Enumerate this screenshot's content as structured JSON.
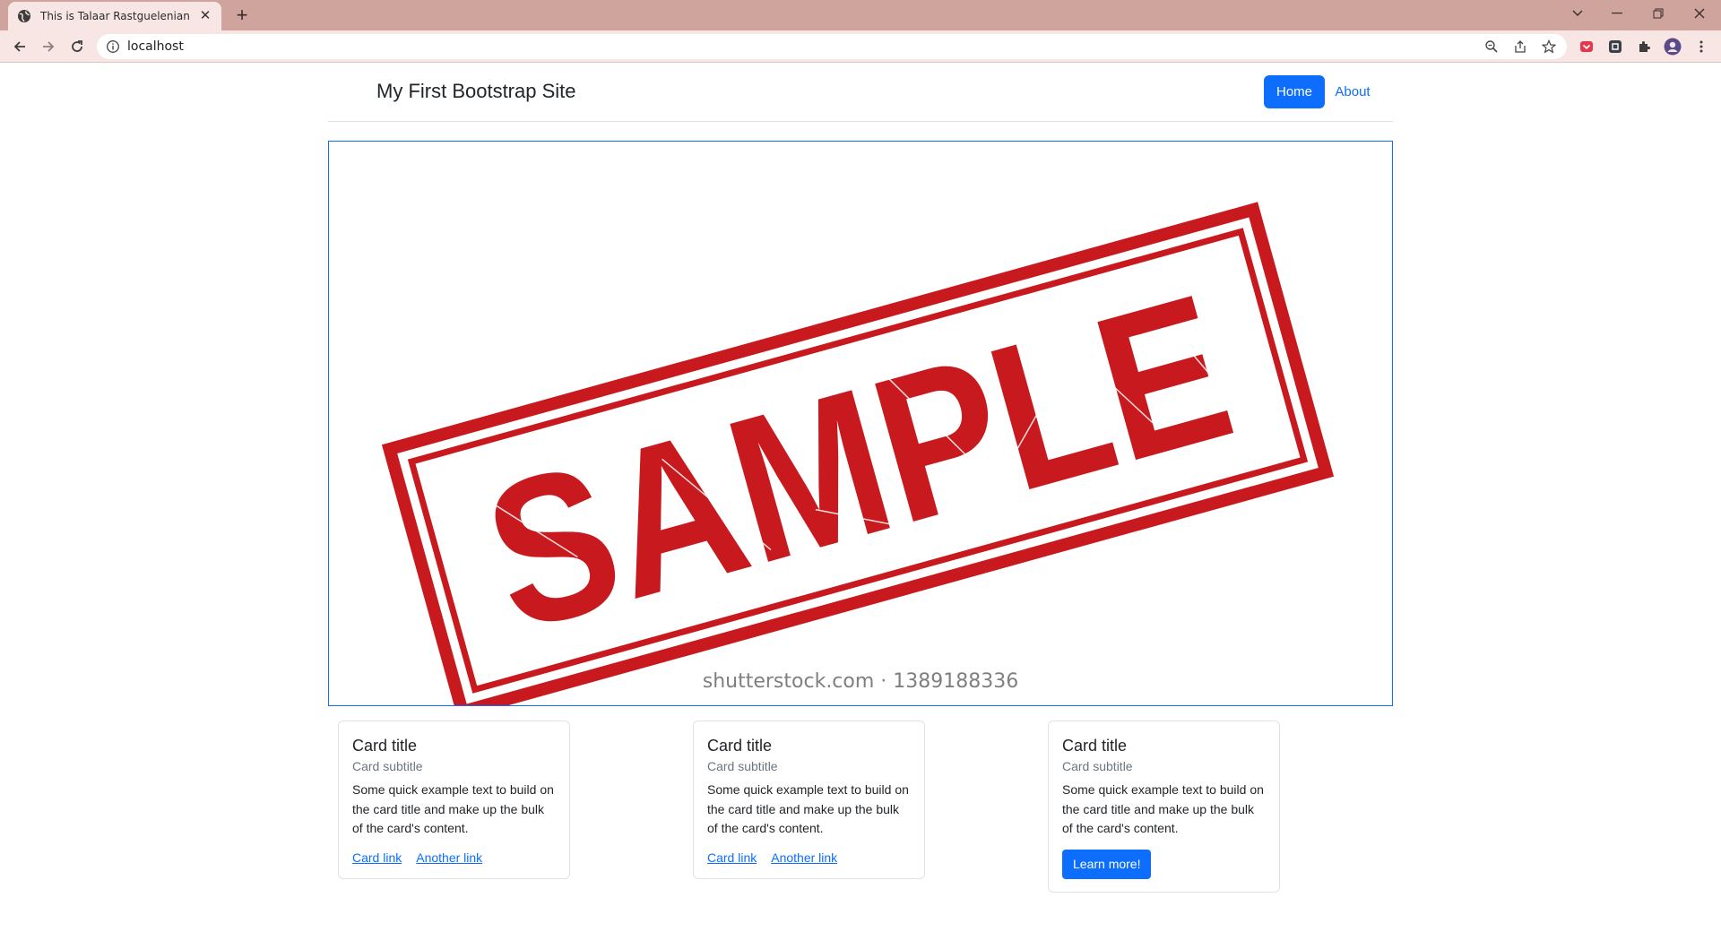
{
  "browser": {
    "tab_title": "This is Talaar Rastguelenian Website",
    "url": "localhost"
  },
  "colors": {
    "chrome_frame": "#cea49c",
    "chrome_toolbar": "#f7e6e3",
    "primary": "#0d6efd",
    "stamp_red": "#c81a1e"
  },
  "site": {
    "brand": "My First Bootstrap Site",
    "nav": {
      "home": "Home",
      "about": "About"
    }
  },
  "hero": {
    "stamp_text": "SAMPLE",
    "watermark": "shutterstock.com · 1389188336"
  },
  "cards": [
    {
      "title": "Card title",
      "subtitle": "Card subtitle",
      "text": "Some quick example text to build on the card title and make up the bulk of the card's content.",
      "link1": "Card link",
      "link2": "Another link"
    },
    {
      "title": "Card title",
      "subtitle": "Card subtitle",
      "text": "Some quick example text to build on the card title and make up the bulk of the card's content.",
      "link1": "Card link",
      "link2": "Another link"
    },
    {
      "title": "Card title",
      "subtitle": "Card subtitle",
      "text": "Some quick example text to build on the card title and make up the bulk of the card's content.",
      "button": "Learn more!"
    }
  ]
}
